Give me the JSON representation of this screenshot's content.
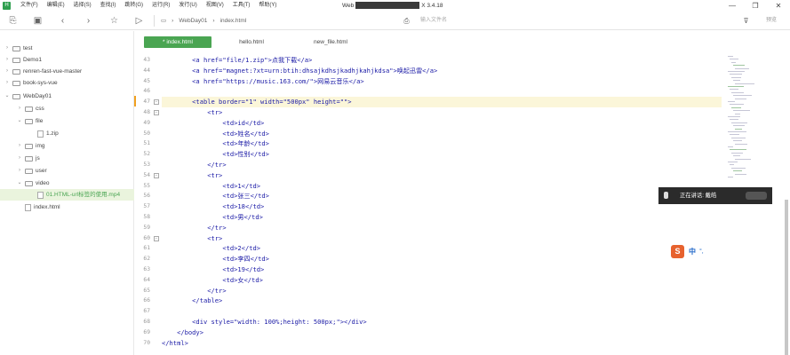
{
  "titlebar": {
    "menu": [
      "文件(F)",
      "编辑(E)",
      "选择(S)",
      "查找(I)",
      "跳转(G)",
      "运行(R)",
      "发行(U)",
      "视图(V)",
      "工具(T)",
      "帮助(Y)"
    ],
    "title_left": "Web",
    "title_right": "X 3.4.18",
    "controls": [
      "—",
      "❐",
      "✕"
    ]
  },
  "toolbar": {
    "breadcrumb": [
      "WebDay01",
      "index.html"
    ],
    "search_placeholder": "输入文件名",
    "preview_label": "预览"
  },
  "sidebar": {
    "items": [
      {
        "label": "test",
        "type": "folder",
        "arrow": "›"
      },
      {
        "label": "Demo1",
        "type": "folder",
        "arrow": "›"
      },
      {
        "label": "renren-fast-vue-master",
        "type": "folder",
        "arrow": "›"
      },
      {
        "label": "book-sys-vue",
        "type": "folder",
        "arrow": "›"
      },
      {
        "label": "WebDay01",
        "type": "folder",
        "arrow": "⌄"
      },
      {
        "label": "css",
        "type": "folder",
        "arrow": "›"
      },
      {
        "label": "file",
        "type": "folder",
        "arrow": "⌄"
      },
      {
        "label": "1.zip",
        "type": "file",
        "arrow": ""
      },
      {
        "label": "img",
        "type": "folder",
        "arrow": "›"
      },
      {
        "label": "js",
        "type": "folder",
        "arrow": "›"
      },
      {
        "label": "user",
        "type": "folder",
        "arrow": "›"
      },
      {
        "label": "video",
        "type": "folder",
        "arrow": "⌄"
      },
      {
        "label": "01.HTML-url标签的使用.mp4",
        "type": "file",
        "arrow": ""
      },
      {
        "label": "index.html",
        "type": "file",
        "arrow": ""
      }
    ]
  },
  "tabs": [
    {
      "label": "* index.html",
      "active": true
    },
    {
      "label": "hello.html",
      "active": false
    },
    {
      "label": "new_file.html",
      "active": false
    }
  ],
  "editor": {
    "lines": [
      {
        "n": "43",
        "text": "        <a href=\"file/1.zip\">点我下载</a>"
      },
      {
        "n": "44",
        "text": "        <a href=\"magnet:?xt=urn:btih:dhsajkdhsjkadhjkahjkdsa\">唤起迅雷</a>"
      },
      {
        "n": "45",
        "text": "        <a href=\"https://music.163.com/\">网易云音乐</a>"
      },
      {
        "n": "46",
        "text": ""
      },
      {
        "n": "47",
        "text": "        <table border=\"1\" width=\"500px\" height=\"\">"
      },
      {
        "n": "48",
        "text": "            <tr>"
      },
      {
        "n": "49",
        "text": "                <td>id</td>"
      },
      {
        "n": "50",
        "text": "                <td>姓名</td>"
      },
      {
        "n": "51",
        "text": "                <td>年龄</td>"
      },
      {
        "n": "52",
        "text": "                <td>性别</td>"
      },
      {
        "n": "53",
        "text": "            </tr>"
      },
      {
        "n": "54",
        "text": "            <tr>"
      },
      {
        "n": "55",
        "text": "                <td>1</td>"
      },
      {
        "n": "56",
        "text": "                <td>张三</td>"
      },
      {
        "n": "57",
        "text": "                <td>18</td>"
      },
      {
        "n": "58",
        "text": "                <td>男</td>"
      },
      {
        "n": "59",
        "text": "            </tr>"
      },
      {
        "n": "60",
        "text": "            <tr>"
      },
      {
        "n": "61",
        "text": "                <td>2</td>"
      },
      {
        "n": "62",
        "text": "                <td>李四</td>"
      },
      {
        "n": "63",
        "text": "                <td>19</td>"
      },
      {
        "n": "64",
        "text": "                <td>女</td>"
      },
      {
        "n": "65",
        "text": "            </tr>"
      },
      {
        "n": "66",
        "text": "        </table>"
      },
      {
        "n": "67",
        "text": ""
      },
      {
        "n": "68",
        "text": "        <div style=\"width: 100%;height: 500px;\"></div>"
      },
      {
        "n": "69",
        "text": "    </body>"
      },
      {
        "n": "70",
        "text": "</html>"
      }
    ],
    "current_line": "47",
    "fold_lines": [
      "47",
      "48",
      "54",
      "60"
    ]
  },
  "speech_widget": {
    "label": "正在讲话: 戴皓"
  },
  "ime": {
    "logo": "S",
    "mode": "中",
    "punct": "°,"
  },
  "colors": {
    "accent": "#4aa552",
    "tag": "#1a1aa6",
    "current_line": "#fbf6d9"
  }
}
